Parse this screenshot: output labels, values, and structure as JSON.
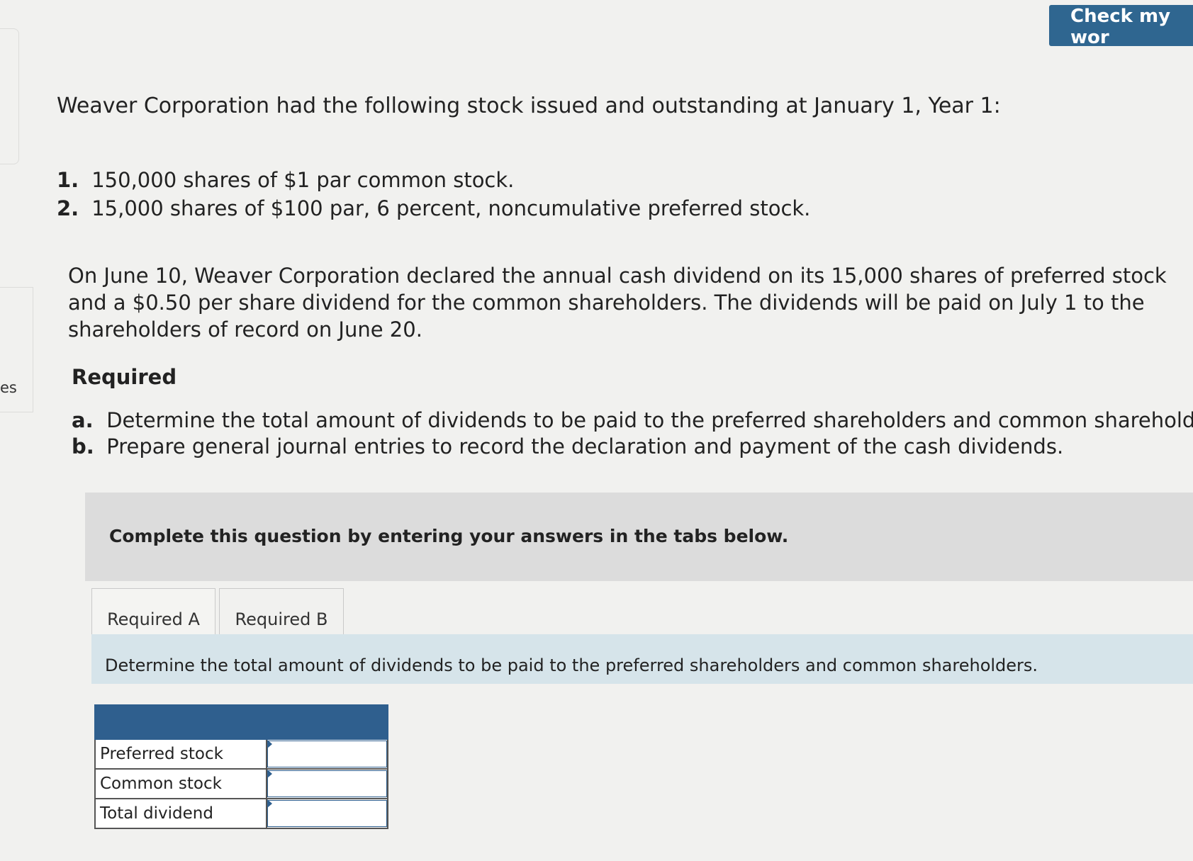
{
  "sidebar": {
    "tab_label": "es"
  },
  "header": {
    "check_button": "Check my wor"
  },
  "problem": {
    "intro": "Weaver Corporation had the following stock issued and outstanding at January 1, Year 1:",
    "stock_items": [
      {
        "number": "1.",
        "text": "150,000 shares of $1 par common stock."
      },
      {
        "number": "2.",
        "text": "15,000 shares of $100 par, 6 percent, noncumulative preferred stock."
      }
    ],
    "paragraph": "On June 10, Weaver Corporation declared the annual cash dividend on its 15,000 shares of preferred stock and a $0.50 per share dividend for the common shareholders. The dividends will be paid on July 1 to the shareholders of record on June 20.",
    "required_heading": "Required",
    "required_items": [
      {
        "letter": "a.",
        "text": "Determine the total amount of dividends to be paid to the preferred shareholders and common shareholders."
      },
      {
        "letter": "b.",
        "text": "Prepare general journal entries to record the declaration and payment of the cash dividends."
      }
    ]
  },
  "instructions": "Complete this question by entering your answers in the tabs below.",
  "tabs": [
    {
      "label": "Required A",
      "active": true
    },
    {
      "label": "Required B",
      "active": false
    }
  ],
  "active_question": "Determine the total amount of dividends to be paid to the preferred shareholders and common shareholders.",
  "answer_table": {
    "rows": [
      {
        "label": "Preferred stock",
        "value": ""
      },
      {
        "label": "Common stock",
        "value": ""
      },
      {
        "label": "Total dividend",
        "value": ""
      }
    ]
  },
  "colors": {
    "button_blue": "#2f6690",
    "table_header": "#2f5f8e",
    "question_band": "#d6e4ea",
    "instruction_band": "#dcdcdc"
  }
}
